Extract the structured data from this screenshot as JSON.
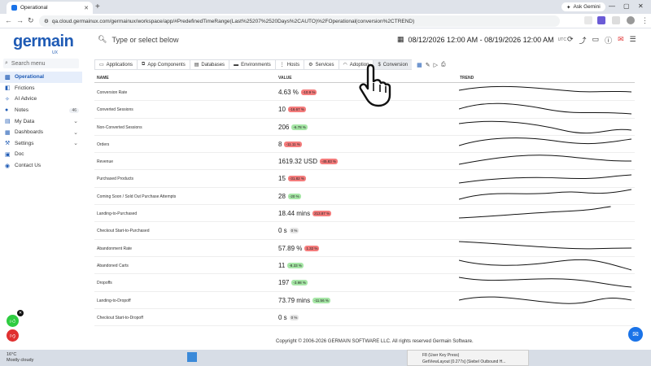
{
  "browser": {
    "tab_title": "Operational",
    "ask_gemini": "Ask Gemini",
    "url": "qa.cloud.germainux.com/germainux/workspace/app/#PredefinedTimeRange(Last%25207%2520Days%2CAUTO)%2FOperational(conversion%2CTREND)"
  },
  "header": {
    "logo": "germain",
    "logo_sub": "UX",
    "search_placeholder": "Type or select below",
    "date_range": "08/12/2026 12:00 AM - 08/19/2026 12:00 AM",
    "timezone": "UTC"
  },
  "sidebar": {
    "search_placeholder": "Search menu",
    "items": [
      {
        "label": "Operational",
        "icon": "chart-icon",
        "active": true
      },
      {
        "label": "Frictions",
        "icon": "friction-icon"
      },
      {
        "label": "AI Advice",
        "icon": "ai-icon"
      },
      {
        "label": "Notes",
        "icon": "note-icon",
        "badge": "46"
      },
      {
        "label": "My Data",
        "icon": "data-icon",
        "chevron": true
      },
      {
        "label": "Dashboards",
        "icon": "dashboard-icon",
        "chevron": true
      },
      {
        "label": "Settings",
        "icon": "settings-icon",
        "chevron": true
      },
      {
        "label": "Doc",
        "icon": "doc-icon"
      },
      {
        "label": "Contact Us",
        "icon": "contact-icon"
      }
    ]
  },
  "tabs": [
    {
      "label": "Applications"
    },
    {
      "label": "App Components"
    },
    {
      "label": "Databases"
    },
    {
      "label": "Environments"
    },
    {
      "label": "Hosts"
    },
    {
      "label": "Services"
    },
    {
      "label": "Adoption"
    },
    {
      "label": "Conversion",
      "active": true
    }
  ],
  "table": {
    "headers": {
      "name": "NAME",
      "value": "VALUE",
      "trend": "TREND"
    },
    "rows": [
      {
        "name": "Conversion Rate",
        "value": "4.63 %",
        "delta": "-10.9 %",
        "color": "red"
      },
      {
        "name": "Converted Sessions",
        "value": "10",
        "delta": "-16.67 %",
        "color": "red"
      },
      {
        "name": "Non-Converted Sessions",
        "value": "206",
        "delta": "-6.78 %",
        "color": "green"
      },
      {
        "name": "Orders",
        "value": "8",
        "delta": "-11.11 %",
        "color": "red"
      },
      {
        "name": "Revenue",
        "value": "1619.32 USD",
        "delta": "-45.83 %",
        "color": "red"
      },
      {
        "name": "Purchased Products",
        "value": "15",
        "delta": "-31.82 %",
        "color": "red"
      },
      {
        "name": "Coming Soon / Sold Out Purchase Attempts",
        "value": "28",
        "delta": "-20 %",
        "color": "green"
      },
      {
        "name": "Landing-to-Purchased",
        "value": "18.44 mins",
        "delta": "213.87 %",
        "color": "red"
      },
      {
        "name": "Checkout Start-to-Purchased",
        "value": "0 s",
        "delta": "0 %",
        "color": "gray"
      },
      {
        "name": "Abandonment Rate",
        "value": "57.89 %",
        "delta": "1.32 %",
        "color": "red"
      },
      {
        "name": "Abandoned Carts",
        "value": "11",
        "delta": "-8.33 %",
        "color": "green"
      },
      {
        "name": "Dropoffs",
        "value": "197",
        "delta": "-3.98 %",
        "color": "green"
      },
      {
        "name": "Landing-to-Dropoff",
        "value": "73.79 mins",
        "delta": "-11.56 %",
        "color": "green"
      },
      {
        "name": "Checkout Start-to-Dropoff",
        "value": "0 s",
        "delta": "0 %",
        "color": "gray"
      }
    ]
  },
  "footer": "Copyright © 2006-2026 GERMAIN SOFTWARE LLC. All rights reserved Germain Software.",
  "taskbar": {
    "weather_temp": "16°C",
    "weather_desc": "Mostly cloudy",
    "popup_line1": "F8 (User Key Press)",
    "popup_line2": "GetViewLayout [0.277s] (Siebel Outbound H..."
  },
  "colors": {
    "brand": "#1f5bb5",
    "red_pill": "#f47c7c",
    "green_pill": "#a6e6a6"
  }
}
